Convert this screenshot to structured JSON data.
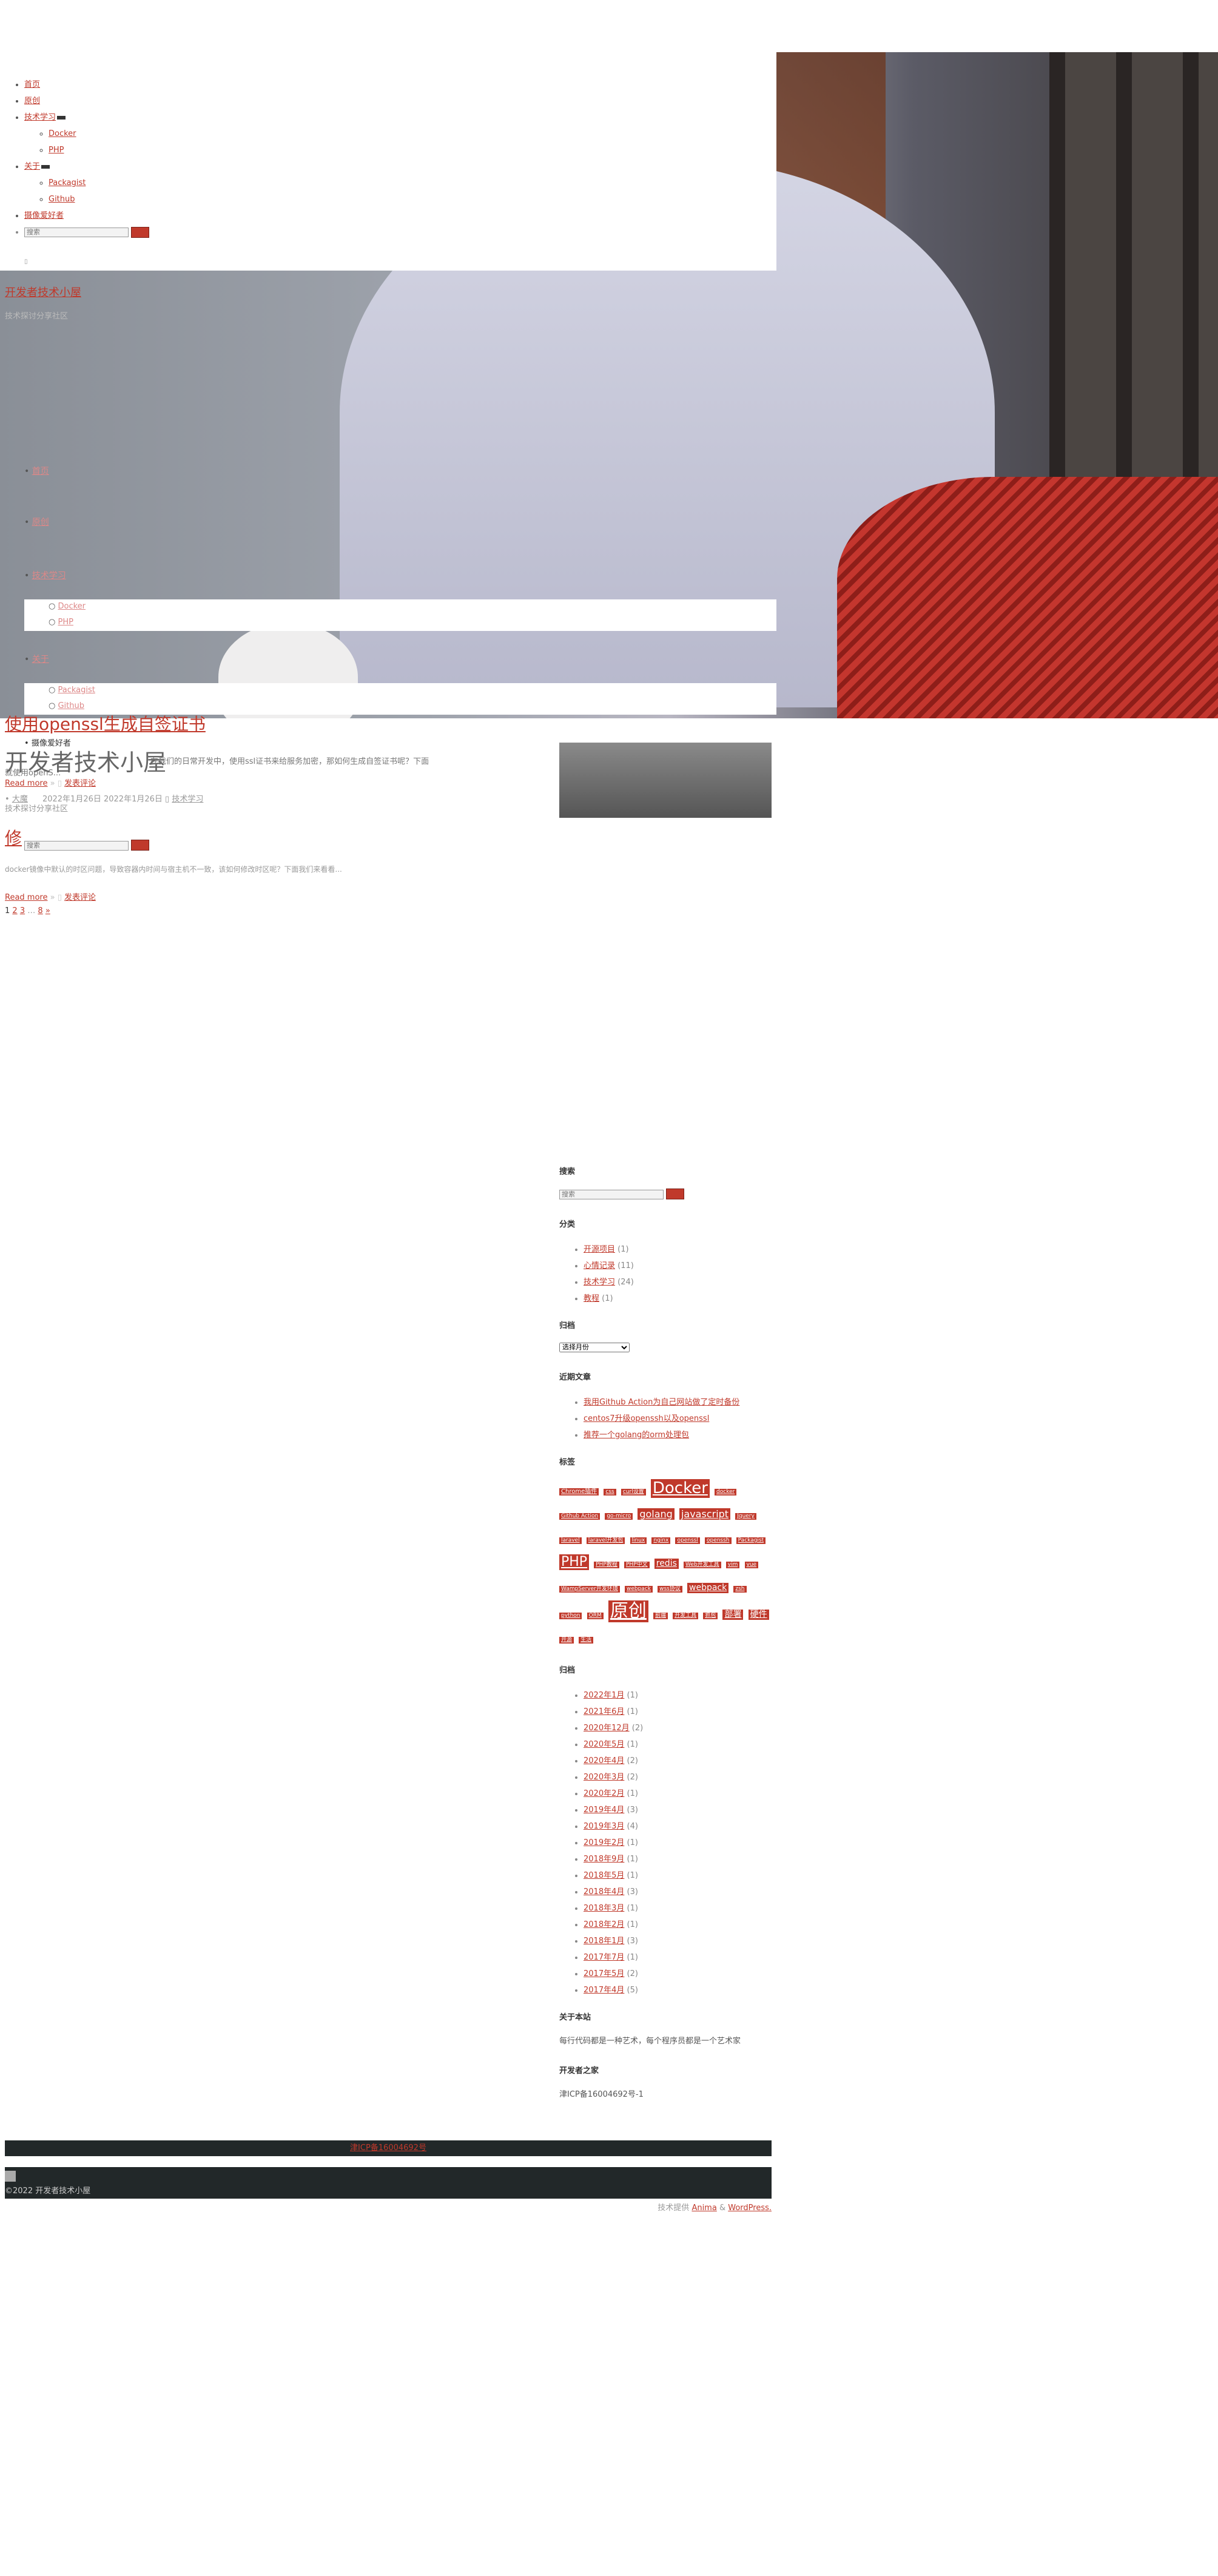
{
  "page": {
    "corner_glyph": "▯"
  },
  "nav": {
    "items": [
      {
        "label": "首页"
      },
      {
        "label": "原创"
      },
      {
        "label": "技术学习",
        "children": [
          {
            "label": "Docker"
          },
          {
            "label": "PHP"
          }
        ]
      },
      {
        "label": "关于",
        "children": [
          {
            "label": "Packagist"
          },
          {
            "label": "Github"
          }
        ]
      },
      {
        "label": "摄像爱好者"
      }
    ],
    "search_placeholder": "搜索"
  },
  "site": {
    "title": "开发者技术小屋",
    "tagline": "技术探讨分享社区"
  },
  "faded_nav": {
    "items": [
      "首页",
      "原创",
      "技术学习",
      "关于"
    ],
    "sub_tech": [
      "Docker",
      "PHP"
    ],
    "sub_about": [
      "Packagist",
      "Github"
    ],
    "photo": "摄像爱好者"
  },
  "posts": [
    {
      "title": "使用openssl生成自签证书",
      "excerpt": "在我们的日常开发中，使用ssl证书来给服务加密，那如何生成自签证书呢？下面就使用openS...",
      "read_more": "Read more",
      "comment": "发表评论",
      "author": "大魔",
      "date": "2022年1月26日 2022年1月26日",
      "category": "技术学习"
    },
    {
      "title": "修",
      "excerpt": "docker镜像中默认的时区问题，导致容器内时间与宿主机不一致，该如何修改时区呢？下面我们来看看...",
      "read_more": "Read more",
      "comment": "发表评论"
    }
  ],
  "pagination": {
    "pages": [
      "1",
      "2",
      "3",
      "…",
      "8",
      "»"
    ]
  },
  "sidebar": {
    "search_title": "搜索",
    "search_placeholder": "搜索",
    "categories_title": "分类",
    "categories": [
      {
        "name": "开源项目",
        "count": "(1)"
      },
      {
        "name": "心情记录",
        "count": "(11)"
      },
      {
        "name": "技术学习",
        "count": "(24)"
      },
      {
        "name": "教程",
        "count": "(1)"
      }
    ],
    "archive_select_title": "归档",
    "archive_select_value": "选择月份",
    "recent_title": "近期文章",
    "recent": [
      "我用Github Action为自己网站做了定时备份",
      "centos7升级openssh以及openssl",
      "推荐一个golang的orm处理包"
    ],
    "tags_title": "标签",
    "tags": [
      {
        "name": "Chrome插件",
        "size": 10
      },
      {
        "name": "css",
        "size": 9
      },
      {
        "name": "curl设置",
        "size": 9
      },
      {
        "name": "Docker",
        "size": 26
      },
      {
        "name": "docker",
        "size": 9
      },
      {
        "name": "Github Action",
        "size": 9
      },
      {
        "name": "go-micro",
        "size": 9
      },
      {
        "name": "golang",
        "size": 16
      },
      {
        "name": "javascript",
        "size": 16
      },
      {
        "name": "Jquery",
        "size": 9
      },
      {
        "name": "laravel",
        "size": 9
      },
      {
        "name": "laravel开发包",
        "size": 9
      },
      {
        "name": "linux",
        "size": 9
      },
      {
        "name": "nginx",
        "size": 9
      },
      {
        "name": "openssl",
        "size": 9
      },
      {
        "name": "openssh",
        "size": 9
      },
      {
        "name": "Packagist",
        "size": 9
      },
      {
        "name": "PHP",
        "size": 22
      },
      {
        "name": "PHP教程",
        "size": 9
      },
      {
        "name": "PHP中文",
        "size": 9
      },
      {
        "name": "redis",
        "size": 14
      },
      {
        "name": "Web开发工具",
        "size": 9
      },
      {
        "name": "vim",
        "size": 9
      },
      {
        "name": "vue",
        "size": 9
      },
      {
        "name": "WampServer开发环境",
        "size": 9
      },
      {
        "name": "webpack",
        "size": 9
      },
      {
        "name": "wss协议",
        "size": 9
      },
      {
        "name": "webpack",
        "size": 14
      },
      {
        "name": "zsh",
        "size": 9
      },
      {
        "name": "python",
        "size": 9
      },
      {
        "name": "ORM",
        "size": 9
      },
      {
        "name": "原创",
        "size": 30
      },
      {
        "name": "前端",
        "size": 9
      },
      {
        "name": "开发工具",
        "size": 9
      },
      {
        "name": "抓包",
        "size": 9
      },
      {
        "name": "部署",
        "size": 14
      },
      {
        "name": "硬件",
        "size": 14
      },
      {
        "name": "开源",
        "size": 9
      },
      {
        "name": "生活",
        "size": 9
      }
    ],
    "archives_title": "归档",
    "archives": [
      {
        "name": "2022年1月",
        "count": "(1)"
      },
      {
        "name": "2021年6月",
        "count": "(1)"
      },
      {
        "name": "2020年12月",
        "count": "(2)"
      },
      {
        "name": "2020年5月",
        "count": "(1)"
      },
      {
        "name": "2020年4月",
        "count": "(2)"
      },
      {
        "name": "2020年3月",
        "count": "(2)"
      },
      {
        "name": "2020年2月",
        "count": "(1)"
      },
      {
        "name": "2019年4月",
        "count": "(3)"
      },
      {
        "name": "2019年3月",
        "count": "(4)"
      },
      {
        "name": "2019年2月",
        "count": "(1)"
      },
      {
        "name": "2018年9月",
        "count": "(1)"
      },
      {
        "name": "2018年5月",
        "count": "(1)"
      },
      {
        "name": "2018年4月",
        "count": "(3)"
      },
      {
        "name": "2018年3月",
        "count": "(1)"
      },
      {
        "name": "2018年2月",
        "count": "(1)"
      },
      {
        "name": "2018年1月",
        "count": "(3)"
      },
      {
        "name": "2017年7月",
        "count": "(1)"
      },
      {
        "name": "2017年5月",
        "count": "(2)"
      },
      {
        "name": "2017年4月",
        "count": "(5)"
      }
    ],
    "about_title": "关于本站",
    "about_text": "每行代码都是一种艺术，每个程序员都是一个艺术家",
    "home_title": "开发者之家",
    "icp_text": "津ICP备16004692号-1"
  },
  "footer": {
    "icp_link": "津ICP备16004692号",
    "copyright": "©2022 开发者技术小屋",
    "credit_prefix": "技术提供",
    "credit_theme": "Anima",
    "credit_and": "&",
    "credit_wp": "WordPress."
  }
}
